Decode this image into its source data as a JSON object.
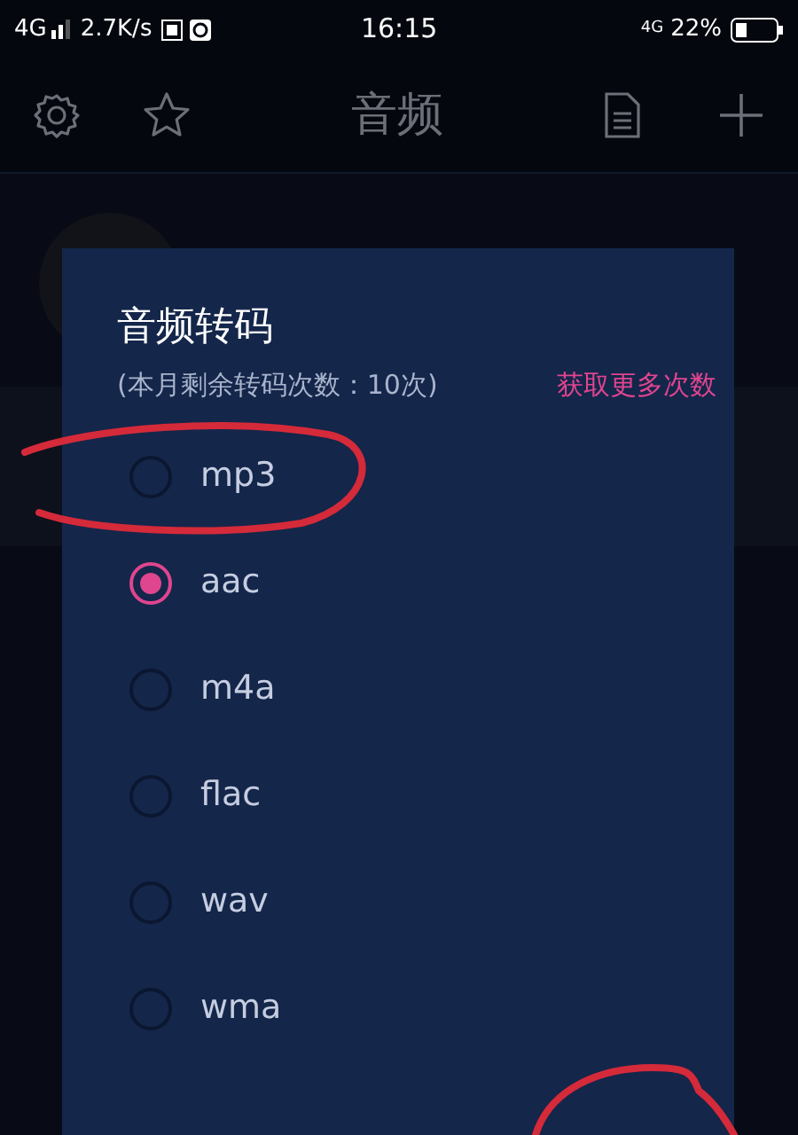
{
  "status_bar": {
    "network": "4G",
    "speed": "2.7K/s",
    "time": "16:15",
    "network_right": "4G",
    "battery": "22%"
  },
  "header": {
    "title": "音频"
  },
  "dialog": {
    "title": "音频转码",
    "subtitle": "(本月剩余转码次数：10次)",
    "link": "获取更多次数",
    "options": [
      {
        "label": "mp3",
        "selected": false
      },
      {
        "label": "aac",
        "selected": true
      },
      {
        "label": "m4a",
        "selected": false
      },
      {
        "label": "flac",
        "selected": false
      },
      {
        "label": "wav",
        "selected": false
      },
      {
        "label": "wma",
        "selected": false
      }
    ]
  }
}
